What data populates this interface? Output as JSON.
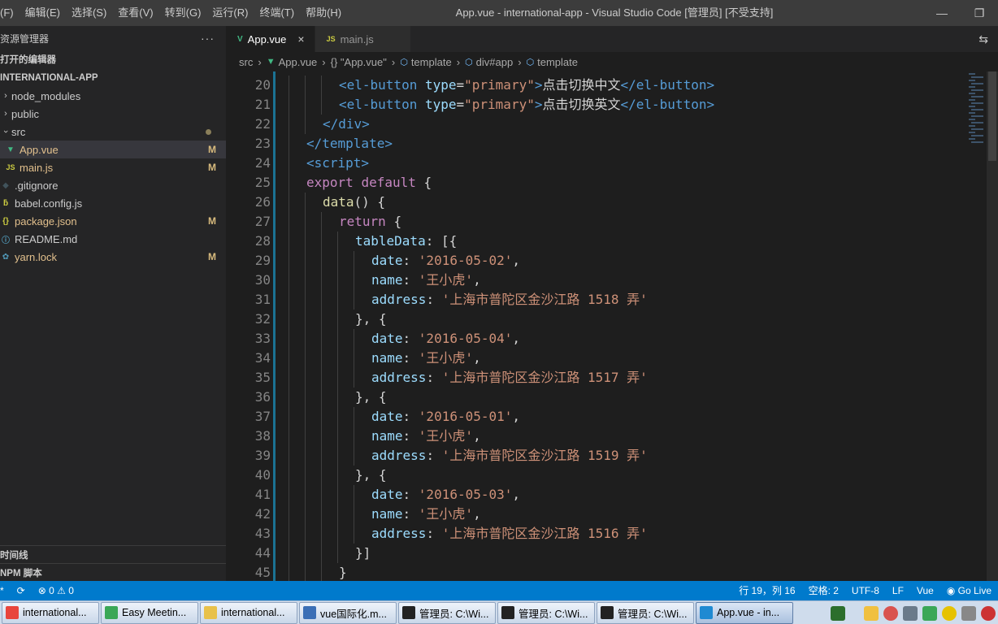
{
  "titlebar": {
    "menu": [
      "(F)",
      "编辑(E)",
      "选择(S)",
      "查看(V)",
      "转到(G)",
      "运行(R)",
      "终端(T)",
      "帮助(H)"
    ],
    "title": "App.vue - international-app - Visual Studio Code [管理员] [不受支持]"
  },
  "sidebar": {
    "header": "资源管理器",
    "more": "···",
    "open_editors": "打开的编辑器",
    "project": "INTERNATIONAL-APP",
    "items": [
      {
        "name": "node_modules",
        "icon": "chevron-right",
        "badge": ""
      },
      {
        "name": "public",
        "icon": "chevron-right",
        "badge": ""
      },
      {
        "name": "src",
        "icon": "chevron-down",
        "badge": "dot"
      },
      {
        "name": "App.vue",
        "icon": "vue",
        "badge": "M"
      },
      {
        "name": "main.js",
        "icon": "js",
        "badge": "M"
      },
      {
        "name": ".gitignore",
        "icon": "git",
        "badge": ""
      },
      {
        "name": "babel.config.js",
        "icon": "babel",
        "badge": ""
      },
      {
        "name": "package.json",
        "icon": "json",
        "badge": "M"
      },
      {
        "name": "README.md",
        "icon": "info",
        "badge": ""
      },
      {
        "name": "yarn.lock",
        "icon": "yarn",
        "badge": "M"
      }
    ],
    "timeline": "时间线",
    "npm": "NPM 脚本"
  },
  "tabs": [
    {
      "label": "App.vue",
      "icon": "V",
      "close": "×"
    },
    {
      "label": "main.js",
      "icon": "JS",
      "close": ""
    }
  ],
  "breadcrumb": [
    "src",
    "App.vue",
    "{} \"App.vue\"",
    "template",
    "div#app",
    "template"
  ],
  "code_lines": [
    {
      "n": "20",
      "i": 3
    },
    {
      "n": "21",
      "i": 3
    },
    {
      "n": "22",
      "i": 2
    },
    {
      "n": "23",
      "i": 1
    },
    {
      "n": "24",
      "i": 1
    },
    {
      "n": "25",
      "i": 1
    },
    {
      "n": "26",
      "i": 2
    },
    {
      "n": "27",
      "i": 3
    },
    {
      "n": "28",
      "i": 4
    },
    {
      "n": "29",
      "i": 5
    },
    {
      "n": "30",
      "i": 5
    },
    {
      "n": "31",
      "i": 5
    },
    {
      "n": "32",
      "i": 4
    },
    {
      "n": "33",
      "i": 5
    },
    {
      "n": "34",
      "i": 5
    },
    {
      "n": "35",
      "i": 5
    },
    {
      "n": "36",
      "i": 4
    },
    {
      "n": "37",
      "i": 5
    },
    {
      "n": "38",
      "i": 5
    },
    {
      "n": "39",
      "i": 5
    },
    {
      "n": "40",
      "i": 4
    },
    {
      "n": "41",
      "i": 5
    },
    {
      "n": "42",
      "i": 5
    },
    {
      "n": "43",
      "i": 5
    },
    {
      "n": "44",
      "i": 4
    },
    {
      "n": "45",
      "i": 3
    }
  ],
  "code": {
    "btn_open": "<el-button ",
    "attr_type": "type",
    "eq": "=",
    "primary": "\"primary\"",
    "gt": ">",
    "text_cn": "点击切换中文",
    "text_en": "点击切换英文",
    "btn_close": "</el-button>",
    "div_close": "</div>",
    "template_close": "</template>",
    "script_open": "<script>",
    "export": "export",
    "default": "default",
    "brace": "{",
    "data_fn": "data",
    "parens": "() {",
    "return": "return",
    "tableData": "tableData",
    "tableOpen": ": [{",
    "date_key": "date",
    "name_key": "name",
    "address_key": "address",
    "colon": ": ",
    "comma": ",",
    "sep": "}, {",
    "end": "}]",
    "close": "}",
    "rows": [
      {
        "date": "'2016-05-02'",
        "name": "'王小虎'",
        "address": "'上海市普陀区金沙江路 1518 弄'"
      },
      {
        "date": "'2016-05-04'",
        "name": "'王小虎'",
        "address": "'上海市普陀区金沙江路 1517 弄'"
      },
      {
        "date": "'2016-05-01'",
        "name": "'王小虎'",
        "address": "'上海市普陀区金沙江路 1519 弄'"
      },
      {
        "date": "'2016-05-03'",
        "name": "'王小虎'",
        "address": "'上海市普陀区金沙江路 1516 弄'"
      }
    ]
  },
  "statusbar": {
    "errors": "⊗ 0",
    "warnings": "⚠ 0",
    "position": "行 19，列 16",
    "spaces": "空格: 2",
    "encoding": "UTF-8",
    "eol": "LF",
    "language": "Vue",
    "golive": "Go Live"
  },
  "taskbar": [
    {
      "label": "international...",
      "color": "#e8453c"
    },
    {
      "label": "Easy Meetin...",
      "color": "#3aa757"
    },
    {
      "label": "international...",
      "color": "#e8c14a"
    },
    {
      "label": "vue国际化.m...",
      "color": "#3b6fb6"
    },
    {
      "label": "管理员: C:\\Wi...",
      "color": "#222222"
    },
    {
      "label": "管理员: C:\\Wi...",
      "color": "#222222"
    },
    {
      "label": "管理员: C:\\Wi...",
      "color": "#222222"
    },
    {
      "label": "App.vue - in...",
      "color": "#1f8ad2"
    }
  ]
}
